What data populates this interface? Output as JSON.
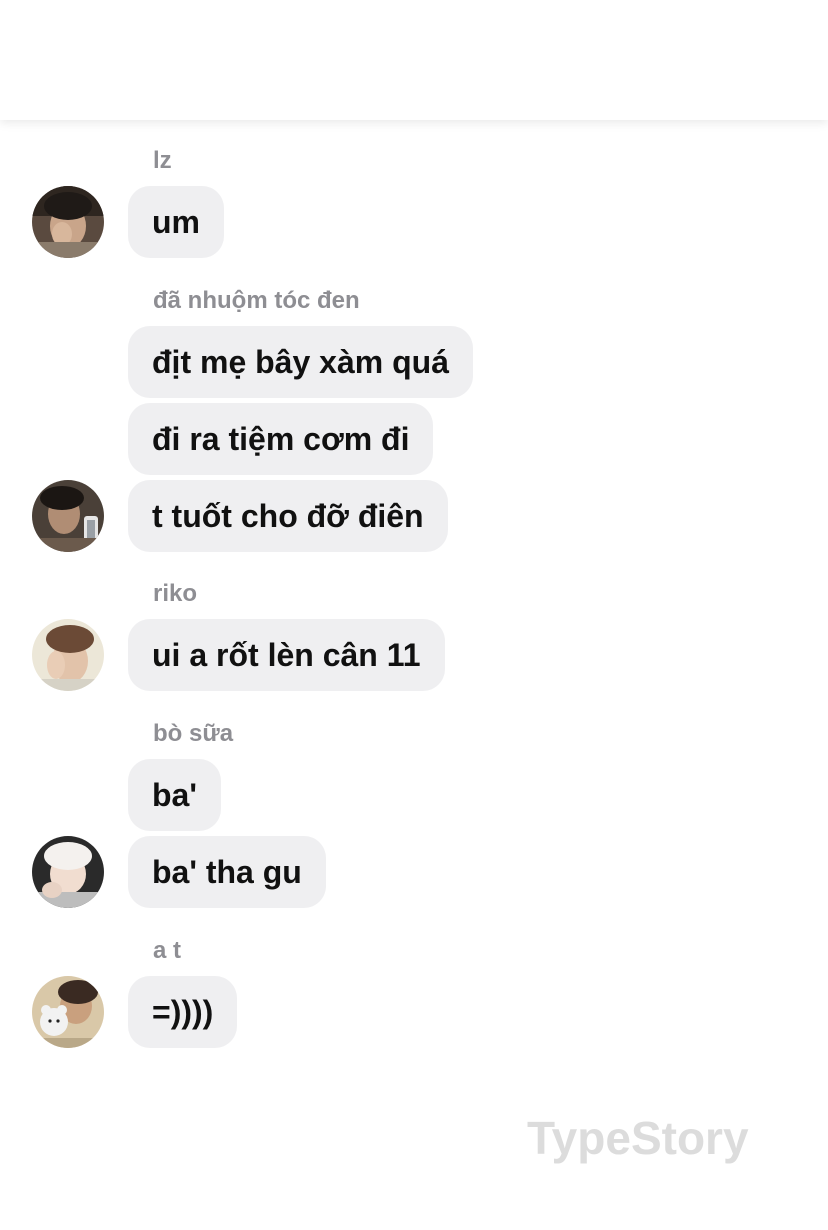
{
  "header": {},
  "messages": [
    {
      "sender": "lz",
      "avatar_icon": "avatar-photo-lz",
      "bubbles": [
        "um"
      ]
    },
    {
      "sender": "đã nhuộm tóc đen",
      "avatar_icon": "avatar-photo-da-nhuom-toc-den",
      "bubbles": [
        "địt mẹ bây xàm quá",
        "đi ra tiệm cơm đi",
        "t tuốt cho đỡ điên"
      ]
    },
    {
      "sender": "riko",
      "avatar_icon": "avatar-photo-riko",
      "bubbles": [
        "ui a rốt lèn cân 11"
      ]
    },
    {
      "sender": "bò sữa",
      "avatar_icon": "avatar-photo-bo-sua",
      "bubbles": [
        "ba'",
        "ba' tha gu"
      ]
    },
    {
      "sender": "a t",
      "avatar_icon": "avatar-photo-a-t",
      "bubbles": [
        "=))))"
      ]
    }
  ],
  "watermark": "TypeStory",
  "colors": {
    "bubble_bg": "#efeff1",
    "sender_name": "#8e8e93",
    "message_text": "#111111",
    "watermark": "#dcdcdc",
    "background": "#ffffff"
  }
}
